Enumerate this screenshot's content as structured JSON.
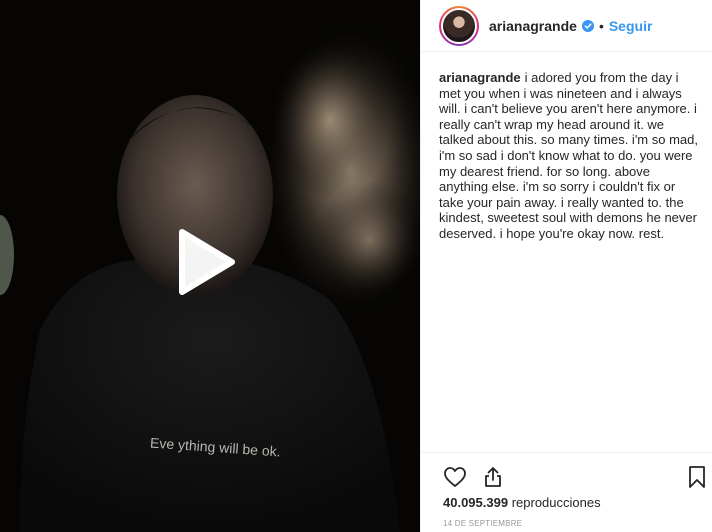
{
  "post": {
    "author": {
      "username": "arianagrande",
      "verified": true,
      "follow_label": "Seguir"
    },
    "media": {
      "type": "video",
      "shirt_text": "Eve ything will be ok."
    },
    "caption": {
      "username": "arianagrande",
      "text": "i adored you from the day i met you when i was nineteen and i always will. i can't believe you aren't here anymore. i really can't wrap my head around it. we talked about this. so many times. i'm so mad, i'm so sad i don't know what to do. you were my dearest friend. for so long. above anything else. i'm so sorry i couldn't fix or take your pain away. i really wanted to. the kindest, sweetest soul with demons he never deserved. i hope you're okay now. rest."
    },
    "actions": {
      "like_icon": "heart-icon",
      "share_icon": "share-icon",
      "save_icon": "bookmark-icon"
    },
    "views": {
      "count": "40.095.399",
      "label": "reproducciones"
    },
    "date": "14 DE SEPTIEMBRE"
  },
  "colors": {
    "link_blue": "#3897f0",
    "text": "#262626",
    "muted": "#999999",
    "border": "#efefef"
  }
}
